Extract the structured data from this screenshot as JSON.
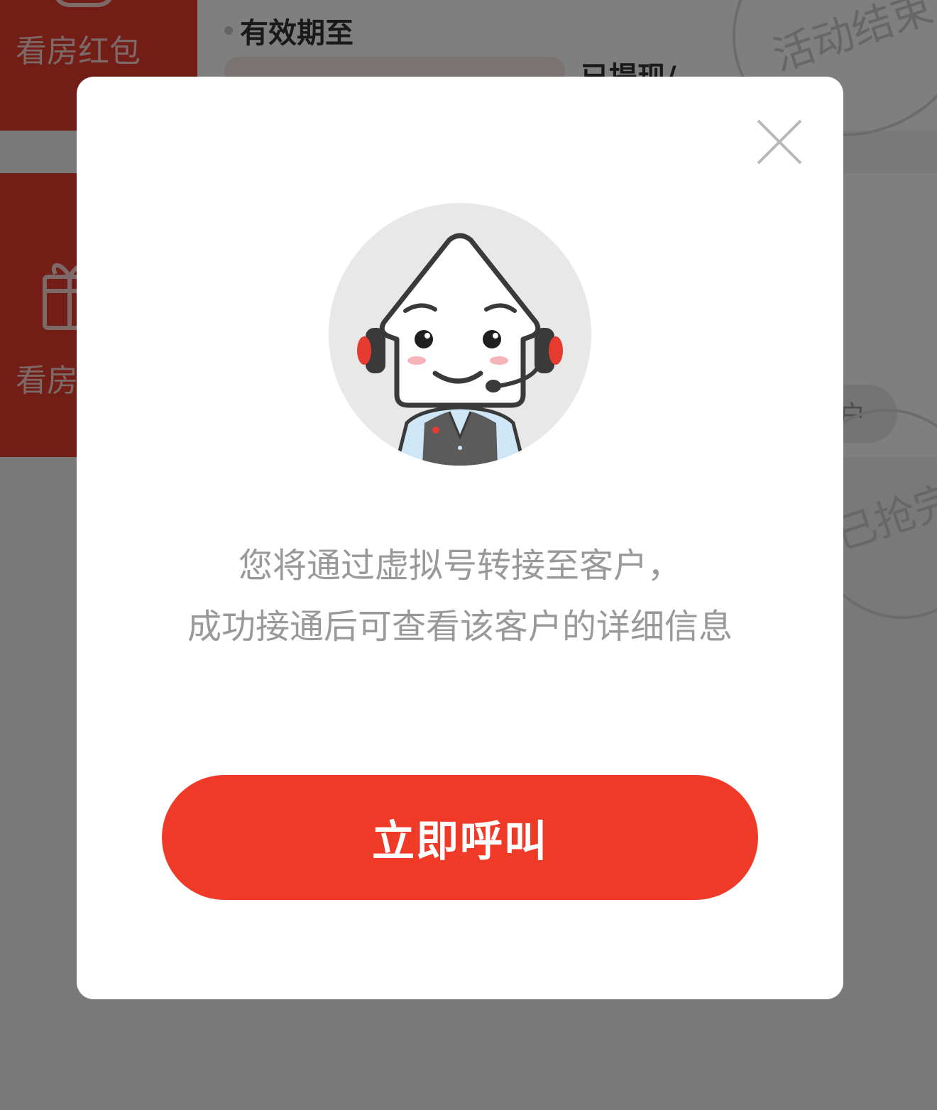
{
  "background": {
    "card1": {
      "side_label": "看房红包",
      "expire_label": "有效期至",
      "withdrawn_label": "已提现/",
      "stamp_text": "活动结束"
    },
    "card2": {
      "side_label": "看房红包",
      "stamp_text": "已抢完",
      "pill_button_label": "户"
    }
  },
  "dialog": {
    "close_icon": "close-icon",
    "avatar_icon": "customer-service-mascot",
    "message_line_1": "您将通过虚拟号转接至客户，",
    "message_line_2": "成功接通后可查看该客户的详细信息",
    "call_button_label": "立即呼叫"
  },
  "colors": {
    "primary": "#ee3a26",
    "brand_red_bg": "#e63b2e",
    "mask": "rgba(0,0,0,0.5)",
    "message_text": "#999999"
  }
}
